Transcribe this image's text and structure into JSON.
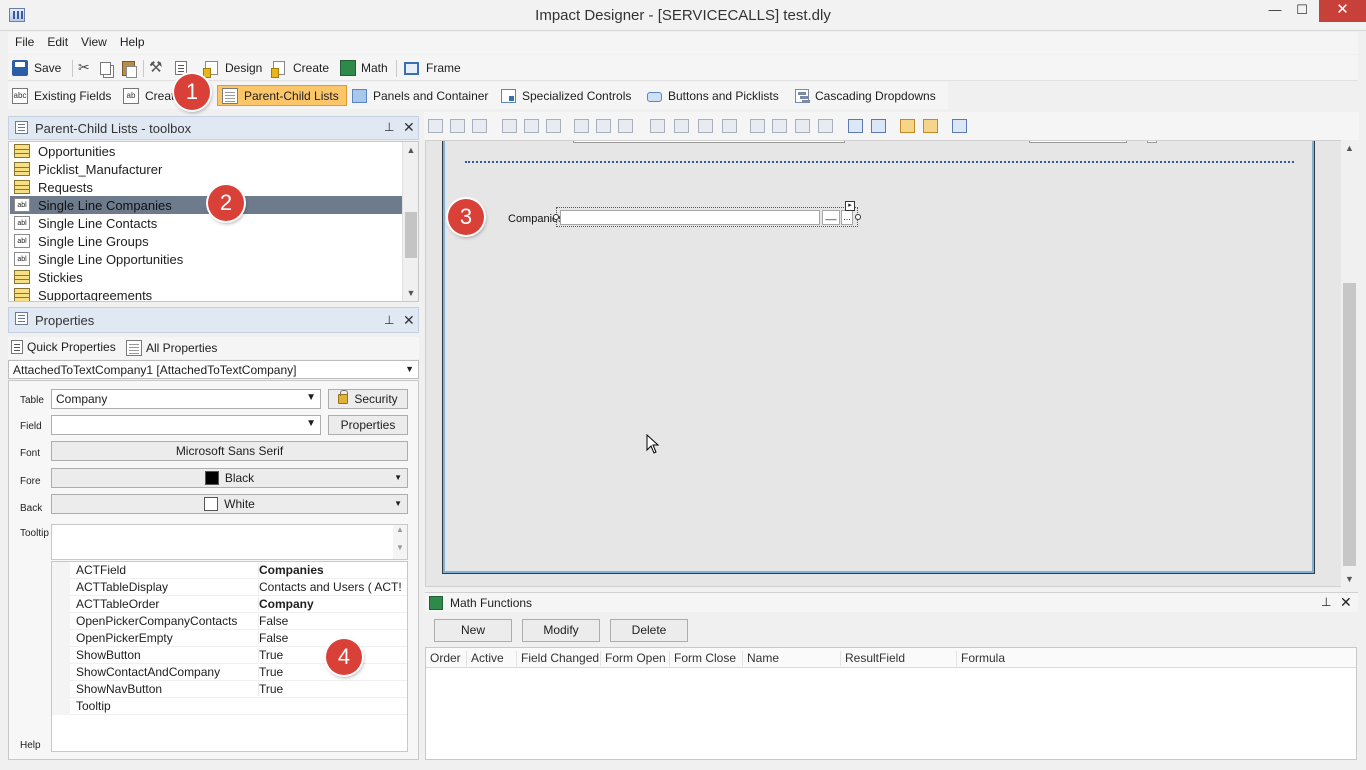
{
  "window": {
    "title": "Impact Designer - [SERVICECALLS] test.dly",
    "min_glyph": "—",
    "max_glyph": "☐",
    "close_glyph": "✕"
  },
  "menu": [
    "File",
    "Edit",
    "View",
    "Help"
  ],
  "toolbar": {
    "save": "Save",
    "design": "Design",
    "create": "Create",
    "math": "Math",
    "frame": "Frame"
  },
  "toolbar2": {
    "existing_fields": "Existing Fields",
    "create": "Creat",
    "parent_child": "Parent-Child Lists",
    "panels": "Panels and Container",
    "specialized": "Specialized Controls",
    "buttons": "Buttons and Picklists",
    "cascading": "Cascading Dropdowns"
  },
  "badges": [
    "1",
    "2",
    "3",
    "4"
  ],
  "toolbox": {
    "title": "Parent-Child Lists - toolbox",
    "pin": "𝟭",
    "items": [
      {
        "label": "Opportunities",
        "icon": "table-icon"
      },
      {
        "label": "Picklist_Manufacturer",
        "icon": "table-icon"
      },
      {
        "label": "Requests",
        "icon": "table-icon"
      },
      {
        "label": "Single Line Companies",
        "icon": "field-icon",
        "selected": true
      },
      {
        "label": "Single Line Contacts",
        "icon": "field-icon"
      },
      {
        "label": "Single Line Groups",
        "icon": "field-icon"
      },
      {
        "label": "Single Line Opportunities",
        "icon": "field-icon"
      },
      {
        "label": "Stickies",
        "icon": "table-icon"
      },
      {
        "label": "Supportagreements",
        "icon": "table-icon"
      }
    ]
  },
  "properties": {
    "title": "Properties",
    "quick_tab": "Quick Properties",
    "all_tab": "All Properties",
    "object": "AttachedToTextCompany1 [AttachedToTextCompany]",
    "labels": {
      "table": "Table",
      "field": "Field",
      "font": "Font",
      "fore": "Fore",
      "back": "Back",
      "tooltip": "Tooltip",
      "help": "Help"
    },
    "table_value": "Company",
    "field_value": "",
    "security_btn": "Security",
    "properties_btn": "Properties",
    "font_value": "Microsoft Sans Serif",
    "fore_value": "Black",
    "fore_color": "#000000",
    "back_value": "White",
    "back_color": "#ffffff",
    "grid": [
      {
        "name": "ACTField",
        "value": "Companies",
        "bold": true
      },
      {
        "name": "ACTTableDisplay",
        "value": "Contacts and Users ( ACT!",
        "bold": false
      },
      {
        "name": "ACTTableOrder",
        "value": "Company",
        "bold": true
      },
      {
        "name": "OpenPickerCompanyContacts",
        "value": "False",
        "bold": false
      },
      {
        "name": "OpenPickerEmpty",
        "value": "False",
        "bold": false
      },
      {
        "name": "ShowButton",
        "value": "True",
        "bold": false
      },
      {
        "name": "ShowContactAndCompany",
        "value": "True",
        "bold": false
      },
      {
        "name": "ShowNavButton",
        "value": "True",
        "bold": false
      },
      {
        "name": "Tooltip",
        "value": "",
        "bold": false
      }
    ]
  },
  "canvas": {
    "field_label": "Companies",
    "nav_glyph": "__",
    "ellipsis": "..."
  },
  "math_functions": {
    "title": "Math Functions",
    "new": "New",
    "modify": "Modify",
    "delete": "Delete",
    "columns": [
      "Order",
      "Active",
      "Field Changed",
      "Form Open",
      "Form Close",
      "Name",
      "ResultField",
      "Formula"
    ]
  },
  "colors": {
    "active_tab": "#fbc56a",
    "badge": "#d94038",
    "selection": "#6d7b8d"
  }
}
